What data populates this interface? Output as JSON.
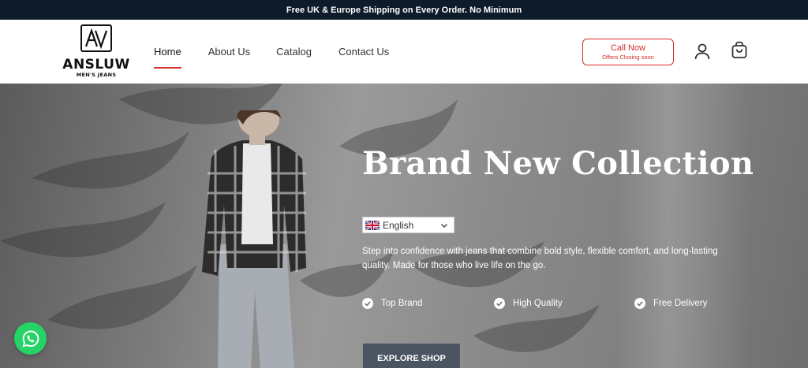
{
  "announcement": "Free UK & Europe Shipping on Every Order. No Minimum",
  "logo": {
    "mark": "AV",
    "name": "ANSLUW",
    "tagline": "MEN'S JEANS"
  },
  "nav": [
    {
      "label": "Home",
      "active": true
    },
    {
      "label": "About Us",
      "active": false
    },
    {
      "label": "Catalog",
      "active": false
    },
    {
      "label": "Contact Us",
      "active": false
    }
  ],
  "call_button": {
    "title": "Call Now",
    "subtitle": "Offers Closing soon"
  },
  "header_icons": [
    "user-icon",
    "cart-icon"
  ],
  "hero": {
    "title": "Brand New Collection",
    "language": {
      "selected": "English",
      "flag": "uk-flag-icon"
    },
    "description": "Step into confidence with jeans that combine bold style, flexible comfort, and long-lasting quality. Made for those who live life on the go.",
    "features": [
      "Top Brand",
      "High Quality",
      "Free Delivery"
    ],
    "cta": "EXPLORE SHOP"
  },
  "colors": {
    "accent": "#d62b2b",
    "topbar": "#0d1b2a",
    "whatsapp": "#25d366"
  }
}
